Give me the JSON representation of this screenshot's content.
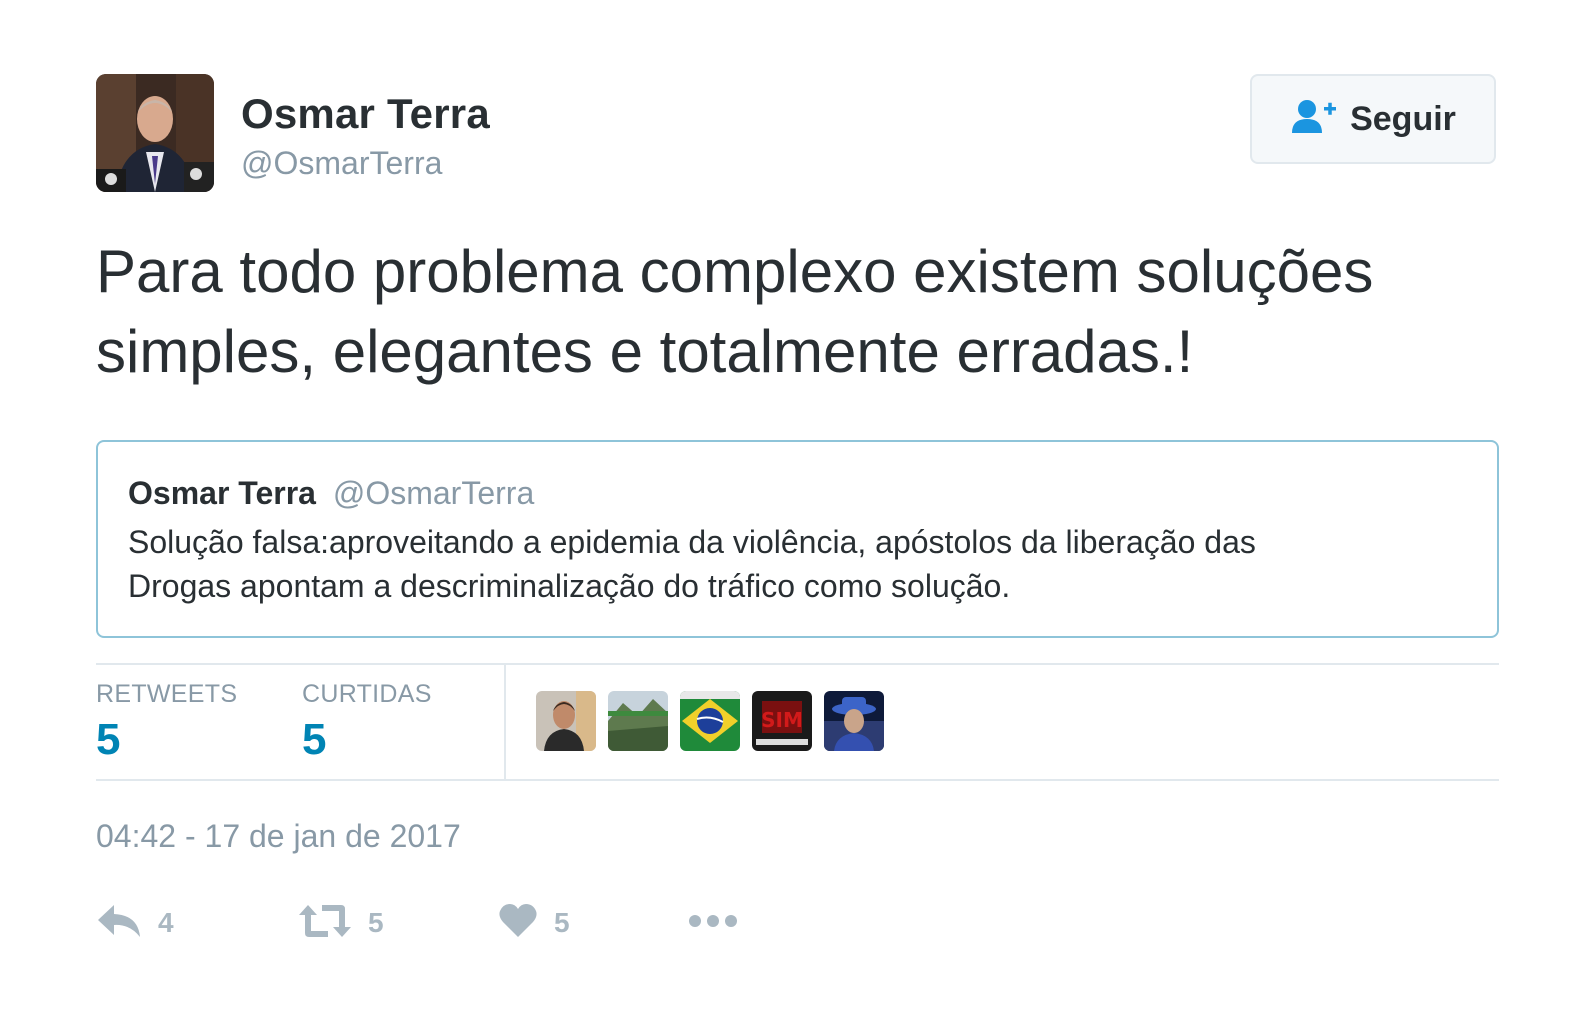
{
  "author": {
    "name": "Osmar Terra",
    "handle": "@OsmarTerra"
  },
  "follow_button": {
    "label": "Seguir"
  },
  "tweet": {
    "text_line1": "Para todo problema complexo existem soluções",
    "text_line2": "simples, elegantes e totalmente erradas.!"
  },
  "quoted_tweet": {
    "name": "Osmar Terra",
    "handle": "@OsmarTerra",
    "text_line1": "Solução falsa:aproveitando a epidemia da violência, apóstolos da liberação das",
    "text_line2": "Drogas apontam a descriminalização do tráfico como solução."
  },
  "stats": {
    "retweets_label": "RETWEETS",
    "retweets_value": "5",
    "likes_label": "CURTIDAS",
    "likes_value": "5"
  },
  "timestamp": "04:42 - 17 de jan de 2017",
  "actions": {
    "reply_count": "4",
    "retweet_count": "5",
    "like_count": "5"
  },
  "colors": {
    "accent": "#1b95e0",
    "stat_value": "#0084b4",
    "muted": "#8899a6",
    "action_icon": "#aab8c2",
    "quote_border": "#8ec4d9"
  }
}
